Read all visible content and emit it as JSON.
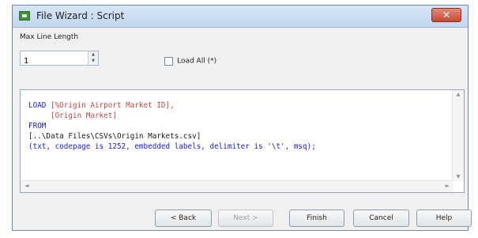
{
  "window": {
    "title": "File Wizard : Script",
    "close_glyph": "✕"
  },
  "options": {
    "max_line_length_label": "Max Line Length",
    "max_line_length_value": "1",
    "load_all_label": "Load All (*)",
    "load_all_checked": false
  },
  "script": {
    "l1_kw": "LOAD",
    "l1_rest": " [%Origin Airport Market ID],",
    "l2": "     [Origin Market]",
    "l3_kw": "FROM",
    "l4": "[..\\Data Files\\CSVs\\Origin Markets.csv]",
    "l5": "(txt, codepage is 1252, embedded labels, delimiter is '\\t', msq);"
  },
  "scrollbar": {
    "up": "▲",
    "down": "▼",
    "left": "◄",
    "right": "►"
  },
  "buttons": {
    "back": "< Back",
    "next": "Next >",
    "finish": "Finish",
    "cancel": "Cancel",
    "help": "Help"
  },
  "icons": [
    "app-icon",
    "close-icon",
    "spinner-up-icon",
    "spinner-down-icon"
  ]
}
